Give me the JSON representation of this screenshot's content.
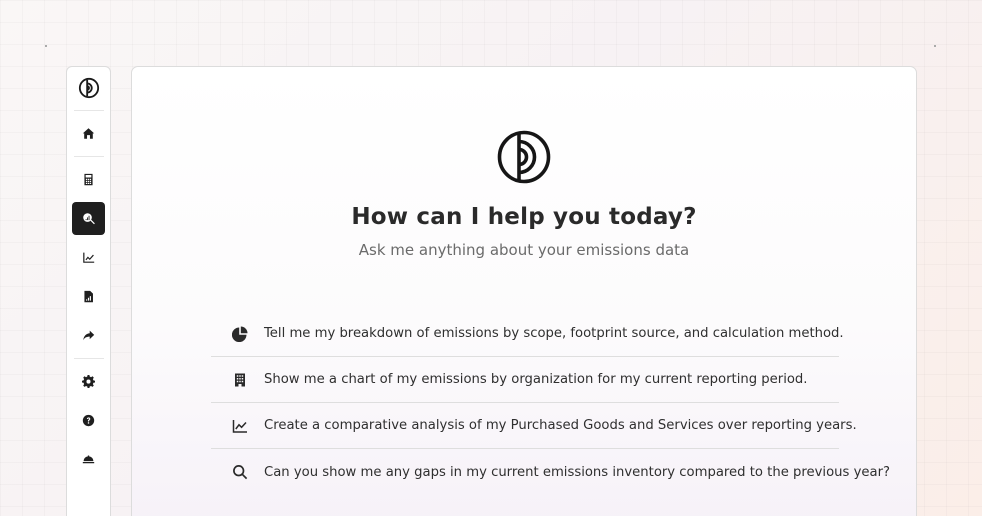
{
  "sidebar": {
    "items": [
      {
        "icon": "home-icon",
        "active": false
      },
      {
        "icon": "calculator-icon",
        "active": false
      },
      {
        "icon": "search-data-icon",
        "active": true
      },
      {
        "icon": "chart-line-icon",
        "active": false
      },
      {
        "icon": "file-report-icon",
        "active": false
      },
      {
        "icon": "share-arrow-icon",
        "active": false
      },
      {
        "icon": "gear-icon",
        "active": false
      },
      {
        "icon": "help-icon",
        "active": false
      },
      {
        "icon": "service-bell-icon",
        "active": false
      }
    ]
  },
  "main": {
    "title": "How can I help you today?",
    "subtitle": "Ask me anything about your emissions data",
    "suggestions": [
      {
        "icon": "pie-chart-icon",
        "text": "Tell me my breakdown of emissions by scope, footprint source, and calculation method."
      },
      {
        "icon": "building-icon",
        "text": "Show me a chart of my emissions by organization for my current reporting period."
      },
      {
        "icon": "line-chart-icon",
        "text": "Create a comparative analysis of my Purchased Goods and Services over reporting years."
      },
      {
        "icon": "search-icon",
        "text": "Can you show me any gaps in my current emissions inventory compared to the previous year?"
      }
    ]
  },
  "colors": {
    "accent": "#1f1f1f",
    "panel_border": "#dcdcdc",
    "text_primary": "#2a2a2a",
    "text_secondary": "#6b6b6b"
  }
}
